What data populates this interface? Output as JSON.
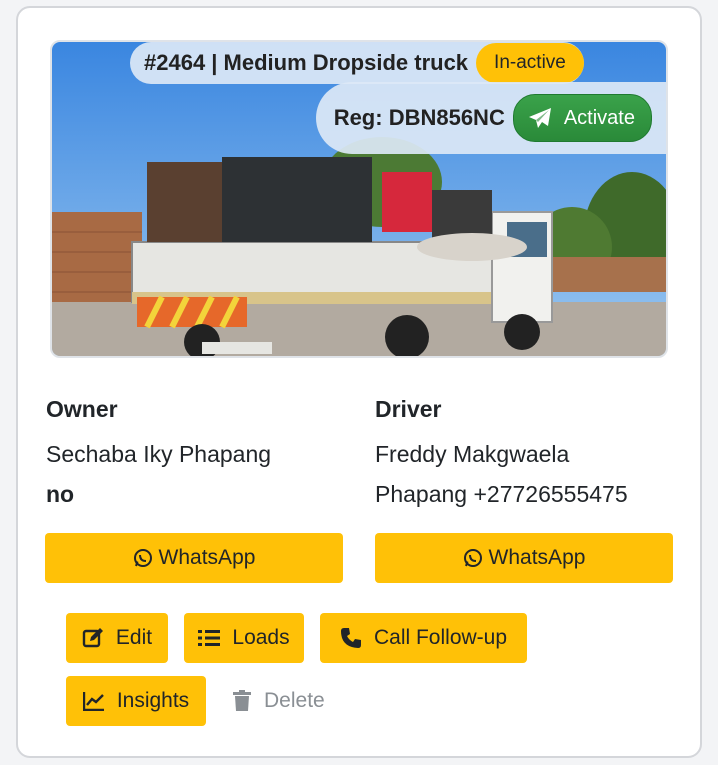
{
  "card": {
    "title": "#2464 | Medium Dropside truck",
    "status": "In-active",
    "registration": "Reg: DBN856NC",
    "activate_label": "Activate"
  },
  "owner": {
    "heading": "Owner",
    "name": "Sechaba Iky Phapang",
    "extra": "no",
    "whatsapp_label": "WhatsApp"
  },
  "driver": {
    "heading": "Driver",
    "name_line1": "Freddy Makgwaela",
    "name_line2": "Phapang +27726555475",
    "whatsapp_label": "WhatsApp"
  },
  "actions": {
    "edit": "Edit",
    "loads": "Loads",
    "call_followup": "Call Follow-up",
    "insights": "Insights",
    "delete": "Delete"
  },
  "colors": {
    "warning": "#ffc107",
    "success": "#2a8a39",
    "muted": "#8a8f94"
  },
  "icons": {
    "activate": "paper-plane-icon",
    "whatsapp": "whatsapp-icon",
    "edit": "pencil-square-icon",
    "loads": "list-icon",
    "call": "phone-icon",
    "insights": "chart-line-icon",
    "delete": "trash-icon"
  }
}
